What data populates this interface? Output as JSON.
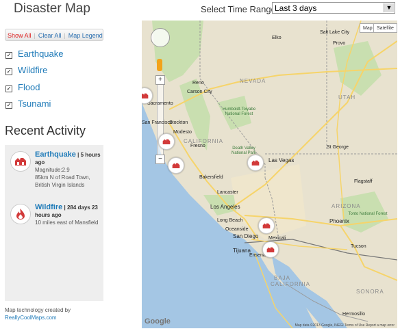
{
  "app": {
    "title": "Disaster Map"
  },
  "time_range": {
    "label": "Select Time Range:",
    "selected": "Last 3 days"
  },
  "toolbar": {
    "show_all": "Show All",
    "clear_all": "Clear All",
    "map_legend": "Map Legend"
  },
  "layers": [
    {
      "label": "Earthquake",
      "checked": true
    },
    {
      "label": "Wildfire",
      "checked": true
    },
    {
      "label": "Flood",
      "checked": true
    },
    {
      "label": "Tsunami",
      "checked": true
    }
  ],
  "recent": {
    "heading": "Recent Activity",
    "items": [
      {
        "type": "Earthquake",
        "icon": "earthquake-icon",
        "time": "| 5 hours ago",
        "detail1": "Magnitude:2.9",
        "detail2": "85km N of Road Town, British Virgin Islands"
      },
      {
        "type": "Wildfire",
        "icon": "wildfire-icon",
        "time": "| 284 days 23 hours ago",
        "detail1": "10 miles east of Mansfield",
        "detail2": ""
      }
    ]
  },
  "credit": {
    "text": "Map technology created by",
    "link": "ReallyCoolMaps.com"
  },
  "map": {
    "type_buttons": [
      "Map",
      "Satellite"
    ],
    "states": [
      "NEVADA",
      "UTAH",
      "CALIFORNIA",
      "ARIZONA",
      "BAJA CALIFORNIA",
      "SONORA"
    ],
    "cities": [
      "Reno",
      "Carson City",
      "Sacramento",
      "San Francisco",
      "Stockton",
      "Modesto",
      "Fresno",
      "Las Vegas",
      "Bakersfield",
      "Lancaster",
      "Los Angeles",
      "Long Beach",
      "Oceanside",
      "San Diego",
      "Tijuana",
      "Mexicali",
      "Ensenada",
      "Phoenix",
      "Tucson",
      "Hermosillo",
      "Provo",
      "St George",
      "Flagstaff",
      "Elko",
      "Salt Lake City"
    ],
    "parks": [
      "Humboldt-Toiyabe National Forest",
      "Death Valley National Park",
      "Tonto National Forest"
    ],
    "google": "Google",
    "footer": "Map data ©2013 Google, INEGI   Terms of Use   Report a map error",
    "colors": {
      "land": "#e8e2cf",
      "water": "#a4c6e4",
      "forest": "#c9dfb0",
      "road": "#f6d46a"
    }
  }
}
